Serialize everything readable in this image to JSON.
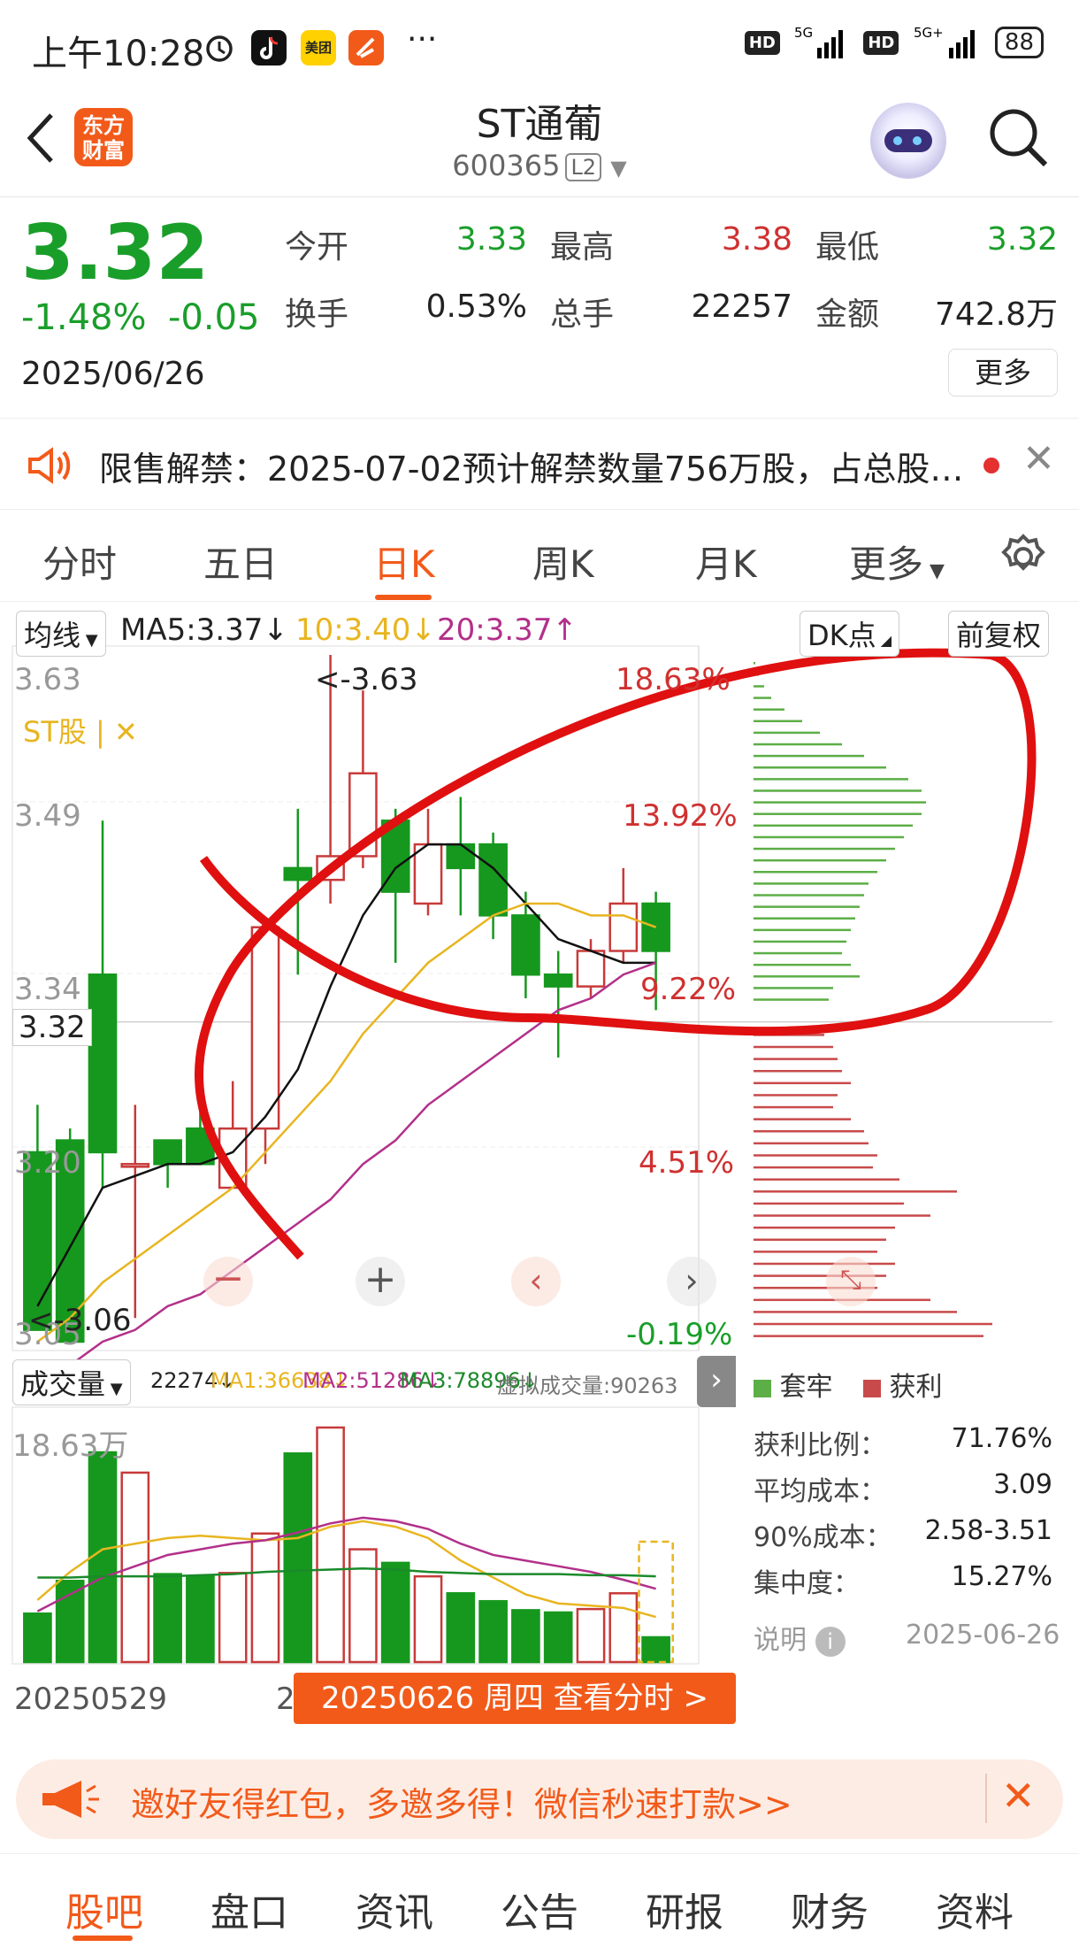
{
  "status_bar": {
    "time": "上午10:28",
    "dots": "···",
    "net1": "5G",
    "net2": "5G+",
    "battery": "88"
  },
  "header": {
    "logo_line1": "东方",
    "logo_line2": "财富",
    "title": "ST通葡",
    "code": "600365",
    "level": "L2"
  },
  "quote": {
    "price": "3.32",
    "change_pct": "-1.48%",
    "change": "-0.05",
    "date": "2025/06/26",
    "fields": [
      {
        "label": "今开",
        "value": "3.33",
        "color": "#1a9e2a"
      },
      {
        "label": "最高",
        "value": "3.38",
        "color": "#d03030"
      },
      {
        "label": "最低",
        "value": "3.32",
        "color": "#1a9e2a"
      },
      {
        "label": "换手",
        "value": "0.53%",
        "color": "#222"
      },
      {
        "label": "总手",
        "value": "22257",
        "color": "#222"
      },
      {
        "label": "金额",
        "value": "742.8万",
        "color": "#222"
      }
    ],
    "more": "更多"
  },
  "notice": {
    "text": "限售解禁：2025-07-02预计解禁数量756万股，占总股…"
  },
  "tabs": [
    {
      "label": "分时"
    },
    {
      "label": "五日"
    },
    {
      "label": "日K"
    },
    {
      "label": "周K"
    },
    {
      "label": "月K"
    },
    {
      "label": "更多"
    }
  ],
  "indicator_bar": {
    "ma_select": "均线",
    "ma5": "MA5:3.37↓",
    "ma10": "10:3.40↓",
    "ma20": "20:3.37↑",
    "dk": "DK点",
    "fq": "前复权"
  },
  "price_axis": {
    "labels": [
      "3.63",
      "3.49",
      "3.34",
      "3.20",
      "3.05"
    ],
    "pct_labels": [
      "18.63%",
      "13.92%",
      "9.22%",
      "4.51%",
      "-0.19%"
    ],
    "current": "3.32",
    "st_tag": "ST股 | ✕",
    "hi_note": "<-3.63",
    "lo_note": "<-3.06"
  },
  "volume_bar": {
    "select": "成交量",
    "vol": "22274↓",
    "ma1": "MA1:36638↓",
    "ma2": "MA2:51286↓",
    "ma3": "MA3:78896↓",
    "virt": "虚拟成交量:90263",
    "max": "18.63万"
  },
  "chip": {
    "legend_trap": "套牢",
    "legend_profit": "获利",
    "rows": [
      {
        "k": "获利比例：",
        "v": "71.76%"
      },
      {
        "k": "平均成本：",
        "v": "3.09"
      },
      {
        "k": "90%成本：",
        "v": "2.58-3.51"
      },
      {
        "k": "集中度：",
        "v": "15.27%"
      }
    ],
    "note": "说明",
    "date": "2025-06-26",
    "green_bars": [
      2,
      6,
      12,
      20,
      35,
      55,
      75,
      100,
      125,
      150,
      175,
      190,
      195,
      190,
      180,
      170,
      160,
      150,
      140,
      130,
      125,
      120,
      115,
      110,
      105,
      100,
      110,
      120,
      90,
      85
    ],
    "red_bars": [
      80,
      90,
      95,
      100,
      110,
      95,
      90,
      110,
      125,
      130,
      140,
      135,
      165,
      230,
      170,
      200,
      160,
      150,
      140,
      160,
      150,
      140,
      200,
      230,
      270,
      260
    ],
    "green_color": "#5cae46",
    "red_color": "#c84a4a"
  },
  "chart_data": {
    "type": "candlestick",
    "dates_shown": [
      "20250529",
      "20250626"
    ],
    "ylim": [
      3.05,
      3.63
    ],
    "candles": [
      {
        "o": 3.21,
        "c": 3.06,
        "h": 3.25,
        "l": 3.06
      },
      {
        "o": 3.22,
        "c": 3.05,
        "h": 3.23,
        "l": 3.05
      },
      {
        "o": 3.36,
        "c": 3.21,
        "h": 3.49,
        "l": 3.18
      },
      {
        "o": 3.2,
        "c": 3.2,
        "h": 3.25,
        "l": 3.07
      },
      {
        "o": 3.22,
        "c": 3.2,
        "h": 3.22,
        "l": 3.18
      },
      {
        "o": 3.23,
        "c": 3.2,
        "h": 3.26,
        "l": 3.2
      },
      {
        "o": 3.18,
        "c": 3.23,
        "h": 3.27,
        "l": 3.18
      },
      {
        "o": 3.23,
        "c": 3.4,
        "h": 3.4,
        "l": 3.2
      },
      {
        "o": 3.45,
        "c": 3.44,
        "h": 3.5,
        "l": 3.36
      },
      {
        "o": 3.44,
        "c": 3.46,
        "h": 3.63,
        "l": 3.42
      },
      {
        "o": 3.46,
        "c": 3.53,
        "h": 3.6,
        "l": 3.45
      },
      {
        "o": 3.49,
        "c": 3.43,
        "h": 3.5,
        "l": 3.37
      },
      {
        "o": 3.42,
        "c": 3.47,
        "h": 3.5,
        "l": 3.41
      },
      {
        "o": 3.47,
        "c": 3.45,
        "h": 3.51,
        "l": 3.41
      },
      {
        "o": 3.47,
        "c": 3.41,
        "h": 3.48,
        "l": 3.39
      },
      {
        "o": 3.41,
        "c": 3.36,
        "h": 3.43,
        "l": 3.34
      },
      {
        "o": 3.36,
        "c": 3.35,
        "h": 3.38,
        "l": 3.29
      },
      {
        "o": 3.35,
        "c": 3.38,
        "h": 3.39,
        "l": 3.34
      },
      {
        "o": 3.38,
        "c": 3.42,
        "h": 3.45,
        "l": 3.37
      },
      {
        "o": 3.42,
        "c": 3.38,
        "h": 3.43,
        "l": 3.33
      }
    ],
    "ma5": [
      3.08,
      3.13,
      3.18,
      3.19,
      3.2,
      3.2,
      3.21,
      3.24,
      3.28,
      3.35,
      3.41,
      3.45,
      3.47,
      3.47,
      3.45,
      3.42,
      3.39,
      3.38,
      3.37,
      3.37
    ],
    "ma10": [
      3.05,
      3.07,
      3.1,
      3.12,
      3.14,
      3.16,
      3.18,
      3.21,
      3.24,
      3.27,
      3.31,
      3.34,
      3.37,
      3.39,
      3.41,
      3.42,
      3.42,
      3.41,
      3.41,
      3.4
    ],
    "ma20": [
      3.02,
      3.03,
      3.05,
      3.06,
      3.08,
      3.09,
      3.11,
      3.13,
      3.15,
      3.17,
      3.2,
      3.22,
      3.25,
      3.27,
      3.29,
      3.31,
      3.33,
      3.34,
      3.36,
      3.37
    ],
    "volumes": [
      4.3,
      7.2,
      18.6,
      16.8,
      7.8,
      7.6,
      7.9,
      11.4,
      18.5,
      20.8,
      10.0,
      8.8,
      7.6,
      6.1,
      5.4,
      4.6,
      4.4,
      4.7,
      6.1,
      2.2
    ],
    "vol_ma1": [
      5.5,
      8,
      10,
      10.5,
      11,
      11.2,
      11,
      10.8,
      11,
      12,
      12.5,
      12,
      11,
      9,
      7.5,
      6,
      5.2,
      5,
      4.8,
      4
    ],
    "vol_ma2": [
      4.5,
      6,
      7.5,
      8.5,
      9.5,
      10,
      10.5,
      10.8,
      11.5,
      12.3,
      12.8,
      12.5,
      11.8,
      10.5,
      9.5,
      9,
      8.5,
      8,
      7.3,
      6.5
    ],
    "vol_ma3": [
      7.5,
      7.5,
      7.6,
      7.6,
      7.6,
      7.7,
      7.8,
      8,
      8.1,
      8.2,
      8.3,
      8.2,
      8,
      7.9,
      7.8,
      7.8,
      7.8,
      7.7,
      7.7,
      7.6
    ]
  },
  "promo": {
    "text": "邀好友得红包，多邀多得！微信秒速打款>>"
  },
  "date_bar": {
    "left": "20250529",
    "mid_prefix": "2",
    "tip": "20250626 周四 查看分时 >"
  },
  "bottom_nav": [
    {
      "label": "股吧"
    },
    {
      "label": "盘口"
    },
    {
      "label": "资讯"
    },
    {
      "label": "公告"
    },
    {
      "label": "研报"
    },
    {
      "label": "财务"
    },
    {
      "label": "资料"
    }
  ]
}
